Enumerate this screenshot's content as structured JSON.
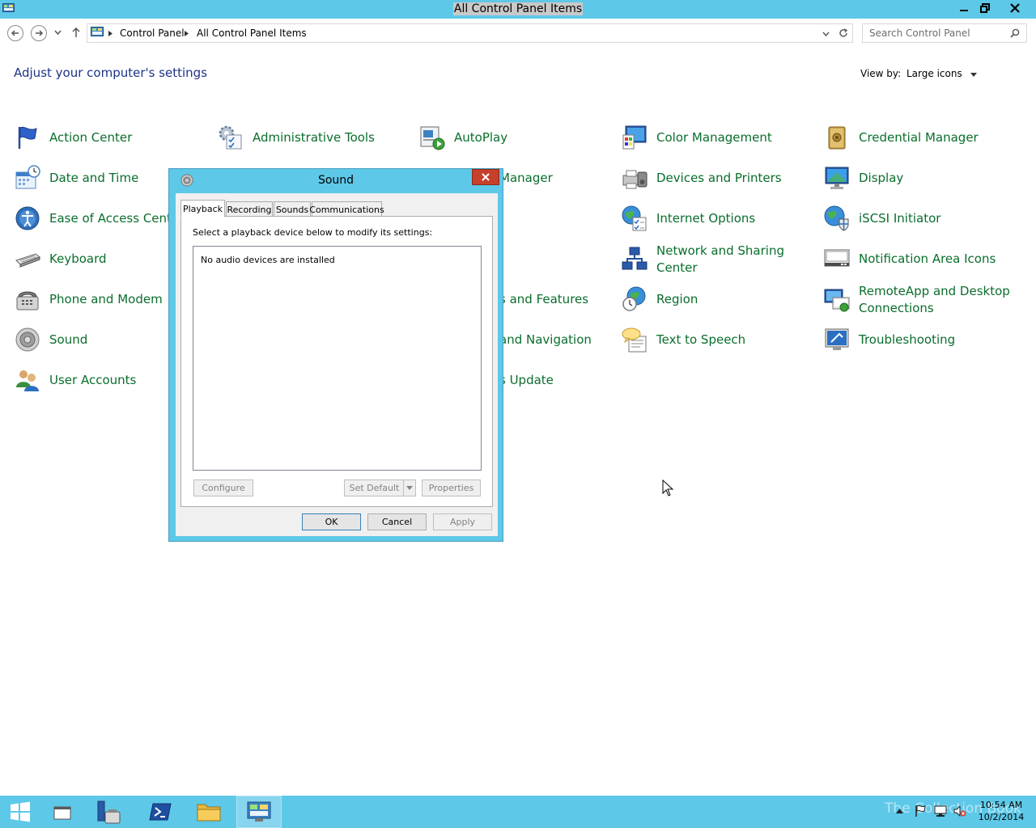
{
  "window": {
    "title": "All Control Panel Items",
    "minimize_glyph": "—",
    "restore_glyph": "❐",
    "close_glyph": "✕"
  },
  "address": {
    "breadcrumbs": [
      "Control Panel",
      "All Control Panel Items"
    ],
    "search_placeholder": "Search Control Panel"
  },
  "page": {
    "heading": "Adjust your computer's settings",
    "view_by_label": "View by:",
    "view_by_value": "Large icons"
  },
  "items": {
    "action_center": "Action Center",
    "administrative_tools": "Administrative Tools",
    "autoplay": "AutoPlay",
    "color_management": "Color Management",
    "credential_manager": "Credential Manager",
    "date_and_time": "Date and Time",
    "device_manager_partial": "Manager",
    "devices_and_printers": "Devices and Printers",
    "display": "Display",
    "ease_of_access": "Ease of Access Center",
    "internet_options": "Internet Options",
    "iscsi_initiator": "iSCSI Initiator",
    "keyboard": "Keyboard",
    "network_and_sharing": "Network and Sharing Center",
    "notification_area_icons": "Notification Area Icons",
    "phone_and_modem": "Phone and Modem",
    "programs_features_partial": "s and Features",
    "region": "Region",
    "remoteapp": "RemoteApp and Desktop Connections",
    "sound": "Sound",
    "taskbar_navigation_partial": "and Navigation",
    "text_to_speech": "Text to Speech",
    "troubleshooting": "Troubleshooting",
    "user_accounts": "User Accounts",
    "windows_update_partial": "s Update"
  },
  "dialog": {
    "title": "Sound",
    "close_glyph": "✕",
    "tabs": [
      "Playback",
      "Recording",
      "Sounds",
      "Communications"
    ],
    "instruction": "Select a playback device below to modify its settings:",
    "empty_message": "No audio devices are installed",
    "configure": "Configure",
    "set_default": "Set Default",
    "properties": "Properties",
    "ok": "OK",
    "cancel": "Cancel",
    "apply": "Apply"
  },
  "taskbar": {
    "time": "10:54 AM",
    "date": "10/2/2014",
    "watermark": "The Collection Book"
  }
}
